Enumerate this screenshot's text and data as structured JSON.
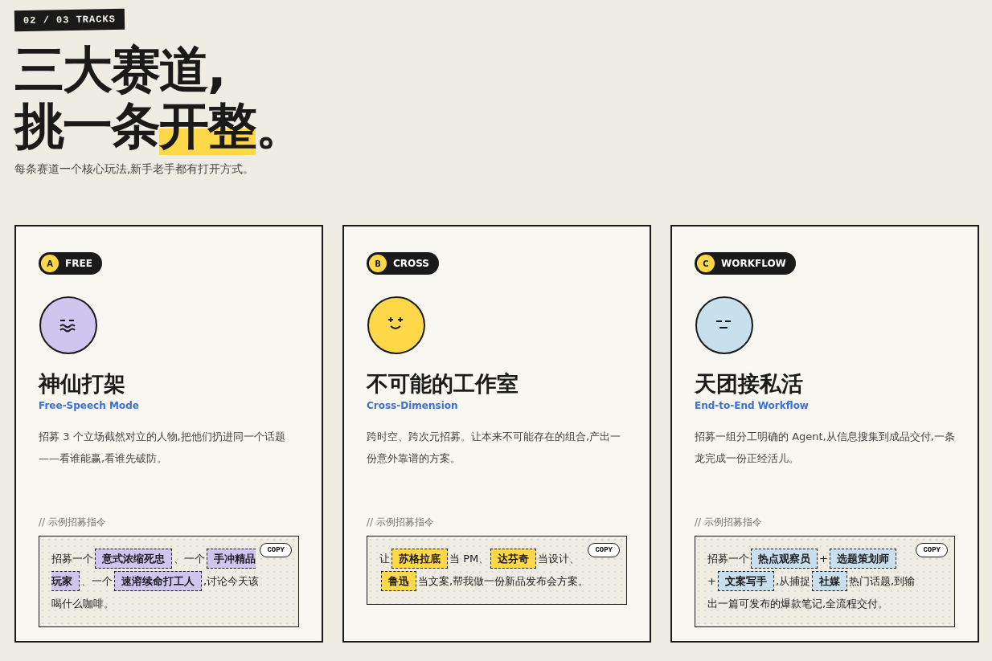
{
  "tag": "02 / 03 TRACKS",
  "title": [
    "三大赛道,",
    "挑一条**开整**。"
  ],
  "subtitle": "每条赛道一个核心玩法,新手老手都有打开方式。",
  "tracks": [
    {
      "letter": "A",
      "badge": "FREE",
      "kind": "wavy",
      "color": "#cfc6f0",
      "name": "神仙打架",
      "english": "Free-Speech Mode",
      "description": "招募 3 个立场截然对立的人物,把他们扔进同一个话题——看谁能赢,看谁先破防。",
      "prompt_label": "// 示例招募指令",
      "copy": "COPY",
      "prompt": [
        {
          "kind": "text",
          "text": "招募一个"
        },
        {
          "kind": "chip",
          "text": "意式浓缩死忠"
        },
        {
          "kind": "text",
          "text": "、一个"
        },
        {
          "kind": "chip",
          "text": "手冲精品玩家"
        },
        {
          "kind": "text",
          "text": "、一个"
        },
        {
          "kind": "chip",
          "text": "速溶续命打工人"
        },
        {
          "kind": "text",
          "text": ",讨论今天该喝什么咖啡。"
        }
      ]
    },
    {
      "letter": "B",
      "badge": "CROSS",
      "kind": "sparkle",
      "color": "#ffd84a",
      "name": "不可能的工作室",
      "english": "Cross-Dimension",
      "description": "跨时空、跨次元招募。让本来不可能存在的组合,产出一份意外靠谱的方案。",
      "prompt_label": "// 示例招募指令",
      "copy": "COPY",
      "prompt": [
        {
          "kind": "text",
          "text": "让"
        },
        {
          "kind": "chip",
          "text": "苏格拉底"
        },
        {
          "kind": "text",
          "text": "当 PM、"
        },
        {
          "kind": "chip",
          "text": "达芬奇"
        },
        {
          "kind": "text",
          "text": "当设计、"
        },
        {
          "kind": "chip",
          "text": "鲁迅"
        },
        {
          "kind": "text",
          "text": "当文案,帮我做一份新品发布会方案。"
        }
      ]
    },
    {
      "letter": "C",
      "badge": "WORKFLOW",
      "kind": "flat",
      "color": "#c8dfee",
      "name": "天团接私活",
      "english": "End-to-End Workflow",
      "description": "招募一组分工明确的 Agent,从信息搜集到成品交付,一条龙完成一份正经活儿。",
      "prompt_label": "// 示例招募指令",
      "copy": "COPY",
      "prompt": [
        {
          "kind": "text",
          "text": "招募一个"
        },
        {
          "kind": "chip",
          "text": "热点观察员"
        },
        {
          "kind": "text",
          "text": "+"
        },
        {
          "kind": "chip",
          "text": "选题策划师"
        },
        {
          "kind": "text",
          "text": "+"
        },
        {
          "kind": "chip",
          "text": "文案写手"
        },
        {
          "kind": "text",
          "text": ",从捕捉"
        },
        {
          "kind": "chip",
          "text": "社媒"
        },
        {
          "kind": "text",
          "text": "热门话题,到输出一篇可发布的爆款笔记,全流程交付。"
        }
      ]
    }
  ]
}
